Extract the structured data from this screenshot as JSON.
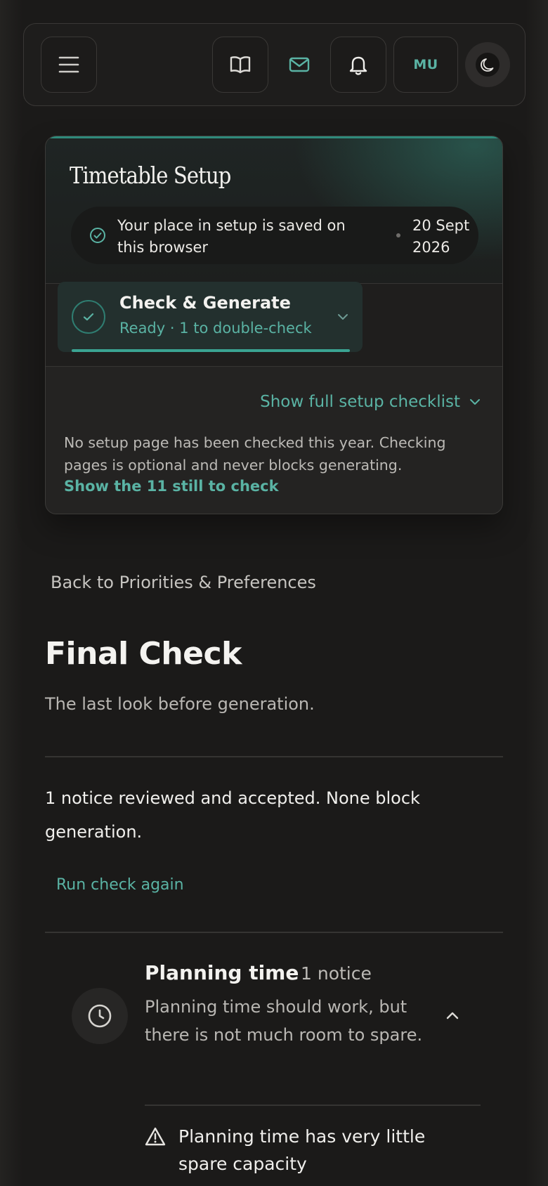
{
  "topbar": {
    "user_initials": "MU"
  },
  "setup": {
    "title": "Timetable Setup",
    "saved_text": "Your place in setup is saved on this browser",
    "saved_date": "20 Sept 2026",
    "step_label": "Check & Generate",
    "step_status": "Ready · 1 to double-check",
    "checklist_link": "Show full setup checklist",
    "note": "No setup page has been checked this year. Checking pages is optional and never blocks generating.",
    "still_link": "Show the 11 still to check"
  },
  "main": {
    "back_link": "Back to Priorities & Preferences",
    "title": "Final Check",
    "subtitle": "The last look before generation.",
    "summary": "1 notice reviewed and accepted. None block generation.",
    "run_again": "Run check again"
  },
  "notice": {
    "title": "Planning time",
    "count": "1 notice",
    "description": "Planning time should work, but there is not much room to spare.",
    "item_text": "Planning time has very little spare capacity"
  },
  "colors": {
    "accent": "#5ab3a4",
    "background": "#1b1a19",
    "card": "#242322"
  }
}
